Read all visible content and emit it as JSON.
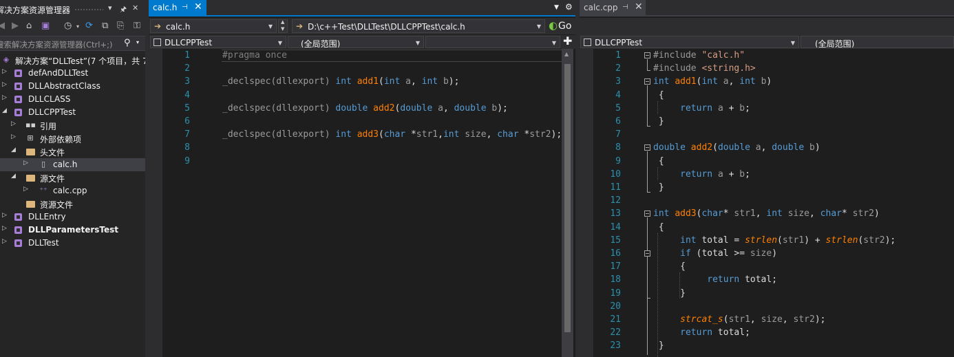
{
  "solution_explorer": {
    "title": "解决方案资源管理器",
    "search_placeholder": "搜索解决方案资源管理器(Ctrl+;)",
    "solution_label": "解决方案“DLLTest”(7 个项目，共 7",
    "items": [
      {
        "label": "defAndDLLTest"
      },
      {
        "label": "DLLAbstractClass"
      },
      {
        "label": "DLLCLASS"
      },
      {
        "label": "DLLCPPTest"
      },
      {
        "label": "引用"
      },
      {
        "label": "外部依赖项"
      },
      {
        "label": "头文件"
      },
      {
        "label": "calc.h"
      },
      {
        "label": "源文件"
      },
      {
        "label": "calc.cpp"
      },
      {
        "label": "资源文件"
      },
      {
        "label": "DLLEntry"
      },
      {
        "label": "DLLParametersTest"
      },
      {
        "label": "DLLTest"
      }
    ]
  },
  "editor_left": {
    "tab_label": "calc.h",
    "file_combo": "calc.h",
    "path_combo": "D:\\c++Test\\DLLTest\\DLLCPPTest\\calc.h",
    "go_label": "Go",
    "project_combo": "DLLCPPTest",
    "scope_combo": "(全局范围)",
    "line_numbers": [
      "1",
      "2",
      "3",
      "4",
      "5",
      "6",
      "7",
      "8",
      "9"
    ]
  },
  "editor_right": {
    "tab_label": "calc.cpp",
    "project_combo": "DLLCPPTest",
    "scope_combo": "(全局范围)",
    "line_numbers": [
      "1",
      "2",
      "3",
      "4",
      "5",
      "6",
      "7",
      "8",
      "9",
      "10",
      "11",
      "12",
      "13",
      "14",
      "15",
      "16",
      "17",
      "18",
      "19",
      "20",
      "21",
      "22",
      "23"
    ]
  },
  "colors": {
    "accent": "#007acc",
    "keyword": "#569cd6",
    "function": "#ff8000",
    "line_number": "#2b91af",
    "string": "#d69d85",
    "text": "#dcdcdc"
  }
}
